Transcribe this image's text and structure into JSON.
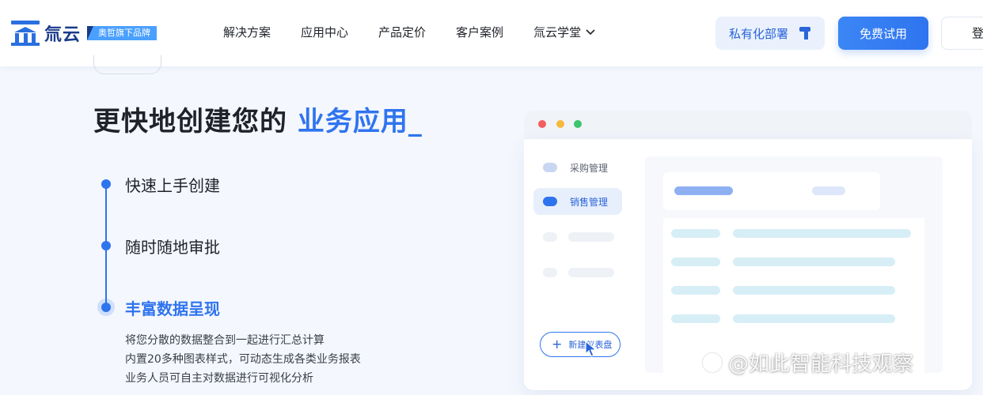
{
  "nav": {
    "logo_text": "氚云",
    "logo_tag": "奥哲旗下品牌",
    "menu": [
      {
        "label": "解决方案"
      },
      {
        "label": "应用中心"
      },
      {
        "label": "产品定价"
      },
      {
        "label": "客户案例"
      },
      {
        "label": "氚云学堂",
        "has_dropdown": true
      }
    ],
    "private_deploy_label": "私有化部署",
    "free_trial_label": "免费试用",
    "login_label": "登"
  },
  "hero": {
    "title_prefix": "更快地创建您的 ",
    "title_highlight": "业务应用_",
    "features": [
      {
        "label": "快速上手创建",
        "active": false
      },
      {
        "label": "随时随地审批",
        "active": false
      },
      {
        "label": "丰富数据呈现",
        "active": true
      }
    ],
    "description_lines": [
      "将您分散的数据整合到一起进行汇总计算",
      "内置20多种图表样式，可动态生成各类业务报表",
      "业务人员可自主对数据进行可视化分析"
    ]
  },
  "mockup": {
    "window_dots": [
      "#f25f5c",
      "#f6b93b",
      "#3ec46d"
    ],
    "sidebar_items": [
      {
        "label": "采购管理",
        "active": false
      },
      {
        "label": "销售管理",
        "active": true
      }
    ],
    "new_dashboard_label": "新建仪表盘"
  },
  "watermark": {
    "text": "@如此智能科技观察"
  },
  "colors": {
    "accent": "#2f74ef",
    "accent_light": "#eaf1fd",
    "text_dark": "#1f2329"
  }
}
